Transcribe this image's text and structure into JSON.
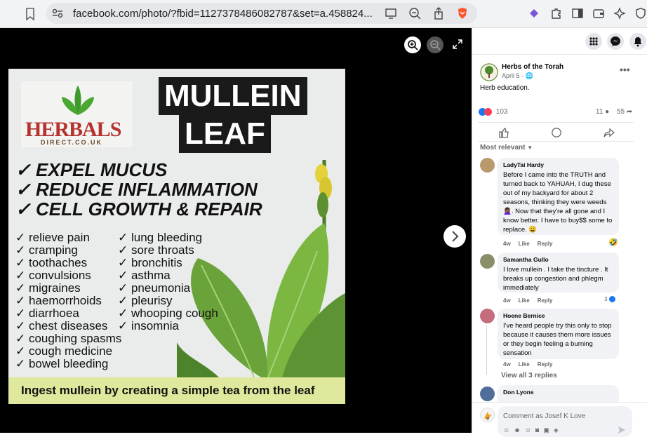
{
  "browser": {
    "url": "facebook.com/photo/?fbid=1127378486082787&set=a.458824...",
    "accent": "#fb542b"
  },
  "poster": {
    "brand": "HERBALS",
    "brand_domain": "DIRECT.CO.UK",
    "title_line1": "MULLEIN",
    "title_line2": "LEAF",
    "main_benefits": [
      "✓ EXPEL MUCUS",
      "✓ REDUCE INFLAMMATION",
      "✓ CELL GROWTH & REPAIR"
    ],
    "column1": [
      "✓ relieve pain",
      "✓ cramping",
      "✓ toothaches",
      "✓ convulsions",
      "✓ migraines",
      "✓ haemorrhoids",
      "✓ diarrhoea",
      "✓ chest diseases",
      "✓ coughing spasms",
      "✓ cough medicine",
      "✓ bowel bleeding"
    ],
    "column2": [
      "✓ lung bleeding",
      "✓ sore throats",
      "✓ bronchitis",
      "✓ asthma",
      "✓ pneumonia",
      "✓ pleurisy",
      "✓ whooping cough",
      "✓ insomnia"
    ],
    "banner": "Ingest mullein by creating a simple tea from the leaf"
  },
  "post": {
    "page_name": "Herbs of the Torah",
    "date": "April 5 ·",
    "caption": "Herb education.",
    "reactions": "103",
    "comments_count": "11",
    "shares_count": "55",
    "sort_label": "Most relevant"
  },
  "comments": [
    {
      "author": "LadyTai Hardy",
      "text": "Before I came into the TRUTH and turned back to YAHUAH, I dug these out of my backyard for about 2 seasons, thinking they were weeds🤦🏾‍♀️. Now that they're all gone and I know better. I have to buy$$ some to replace. 😩",
      "time": "4w",
      "like": "Like",
      "reply": "Reply",
      "reaction": "🤣"
    },
    {
      "author": "Samantha Gullo",
      "text": "I love mullein . I take the tincture . It breaks up congestion and phlegm immediately",
      "time": "4w",
      "like": "Like",
      "reply": "Reply",
      "reaction": "3"
    },
    {
      "author": "Hoene Bernice",
      "text": "I've heard people try this only to stop because it causes them more issues or they begin feeling a burning sensation",
      "time": "4w",
      "like": "Like",
      "reply": "Reply",
      "reaction": ""
    },
    {
      "author": "Don Lyons",
      "text": "",
      "time": "",
      "like": "",
      "reply": "",
      "reaction": ""
    }
  ],
  "view_replies": "View all 3 replies",
  "composer": {
    "placeholder": "Comment as Josef K Love"
  },
  "colors": {
    "fb_blue": "#1877f2",
    "banner": "#dfe89c"
  }
}
